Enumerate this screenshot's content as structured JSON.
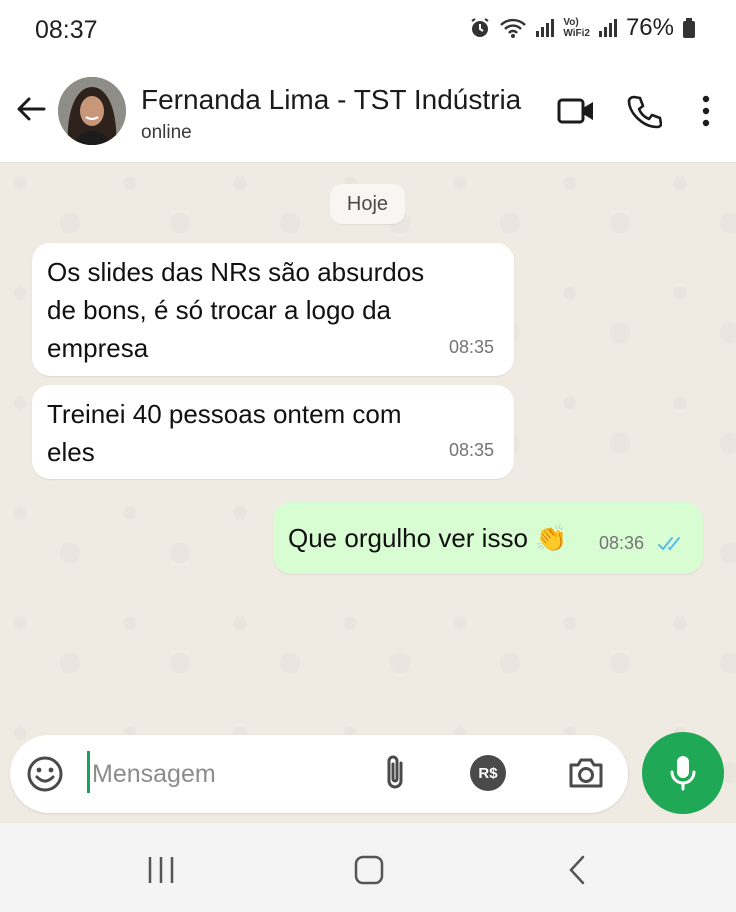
{
  "status_bar": {
    "time": "08:37",
    "icons": [
      "alarm-icon",
      "wifi-icon",
      "signal-icon",
      "volte-wifi2-label",
      "signal-icon-2",
      "battery-icon"
    ],
    "volte_line1": "Vo)",
    "volte_line2": "WiFi2",
    "battery": "76%"
  },
  "header": {
    "contact_name": "Fernanda Lima - TST Indústria",
    "status": "online",
    "icons": [
      "back-arrow-icon",
      "video-call-icon",
      "phone-icon",
      "more-vert-icon"
    ]
  },
  "chat": {
    "date_chip": "Hoje",
    "messages": [
      {
        "direction": "incoming",
        "lines": [
          "Os slides das NRs são absurdos",
          "de bons, é só trocar a logo da",
          "empresa"
        ],
        "time": "08:35"
      },
      {
        "direction": "incoming",
        "lines": [
          "Treinei 40 pessoas ontem com",
          "eles"
        ],
        "time": "08:35"
      },
      {
        "direction": "outgoing",
        "lines": [
          "Que orgulho ver isso 👏"
        ],
        "time": "08:36",
        "status": "read"
      }
    ]
  },
  "composer": {
    "placeholder": "Mensagem",
    "value": "",
    "pay_label": "R$",
    "icons": [
      "emoji-icon",
      "attach-icon",
      "payment-icon",
      "camera-icon",
      "mic-icon"
    ]
  },
  "colors": {
    "incoming_bubble": "#ffffff",
    "outgoing_bubble": "#d9fdd3",
    "accent_green": "#1fa855",
    "read_ticks": "#53bdeb"
  }
}
